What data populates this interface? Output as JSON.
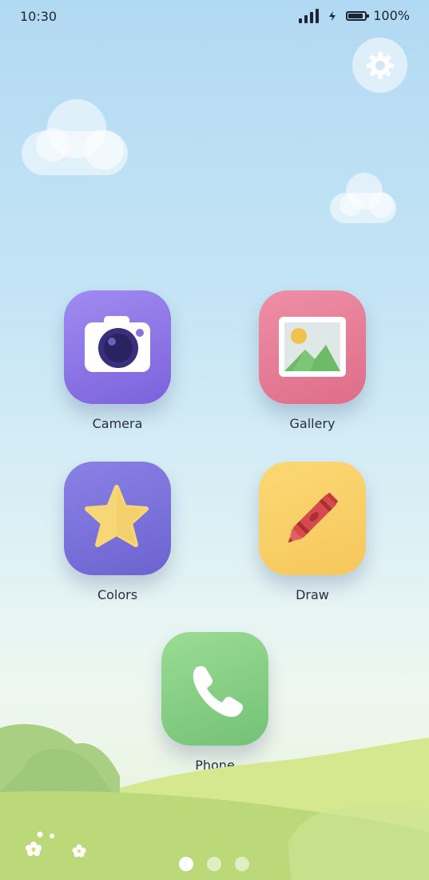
{
  "status_bar": {
    "time": "10:30",
    "battery_text": "100%",
    "battery_level": 1.0
  },
  "settings": {
    "icon": "gear-icon"
  },
  "apps": [
    {
      "label": "Camera",
      "icon": "camera-icon",
      "color": "#8f77e8"
    },
    {
      "label": "Gallery",
      "icon": "image-icon",
      "color": "#e67c96"
    },
    {
      "label": "Colors",
      "icon": "star-icon",
      "color": "#7b72dc"
    },
    {
      "label": "Draw",
      "icon": "crayon-icon",
      "color": "#f8cf68"
    },
    {
      "label": "Phone",
      "icon": "phone-icon",
      "color": "#86cf86"
    }
  ],
  "pages": {
    "count": 3,
    "active_index": 0
  }
}
